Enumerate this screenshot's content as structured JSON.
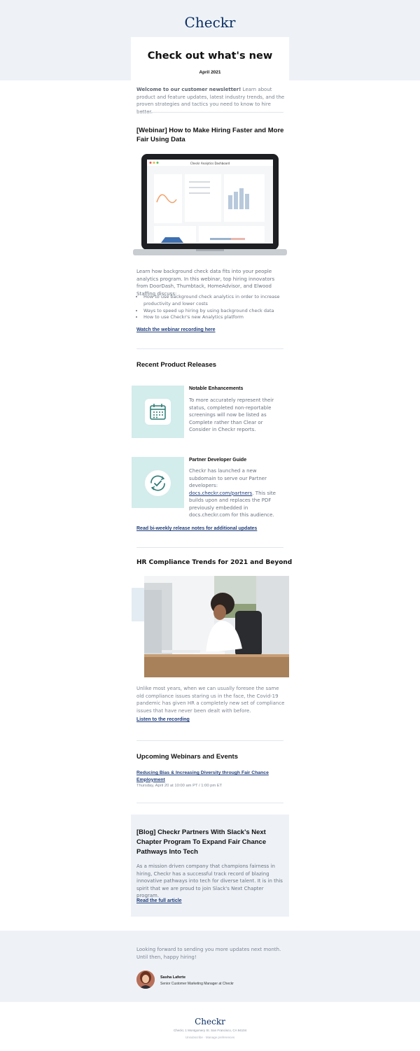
{
  "header": {
    "logo": "Checkr",
    "title": "Check out what's new",
    "date": "April 2021"
  },
  "intro": {
    "bold": "Welcome to our customer newsletter!",
    "text": " Learn about product and feature updates, latest industry trends, and the proven strategies and tactics you need to know to hire better."
  },
  "webinar": {
    "title": "[Webinar] How to Make Hiring Faster and More Fair Using Data",
    "dashboard_title": "Checkr Analytics Dashboard",
    "body": "Learn how background check data fits into your people analytics program. In this webinar, top hiring innovators from DoorDash, Thumbtack, HomeAdvisor, and Elwood Staffing discuss:",
    "bullets": [
      "How to use background check analytics in order to increase productivity and lower costs",
      "Ways to speed up hiring by using background check data",
      "How to use Checkr's new Analytics platform"
    ],
    "link": "Watch the webinar recording here"
  },
  "releases": {
    "title": "Recent Product Releases",
    "items": [
      {
        "title": "Notable Enhancements",
        "text": "To more accurately represent their status, completed non-reportable screenings will now be listed as Complete rather than Clear or Consider in Checkr reports.",
        "icon": "calendar-icon"
      },
      {
        "title": "Partner Developer Guide",
        "text_before": "Checkr has launched a new subdomain to serve our Partner developers: ",
        "link": "docs.checkr.com/partners",
        "text_after": ". This site builds upon and replaces the PDF previously embedded in docs.checkr.com for this audience.",
        "icon": "refresh-check-icon"
      }
    ],
    "link": "Read bi-weekly release notes for additional updates"
  },
  "compliance": {
    "title": "HR Compliance Trends for 2021 and Beyond",
    "body": "Unlike most years, when we can usually foresee the same old compliance issues staring us in the face, the Covid-19 pandemic has given HR a completely new set of compliance issues that have never been dealt with before.",
    "link": "Listen to the recording"
  },
  "events": {
    "title": "Upcoming Webinars and Events",
    "event_link": "Reducing Bias & Increasing Diversity through Fair Chance Employment",
    "event_time": "Thursday, April 20 at 10:00 am PT / 1:00 pm ET"
  },
  "blog": {
    "title": "[Blog] Checkr Partners With Slack's Next Chapter Program To Expand Fair Chance Pathways Into Tech",
    "body": "As a mission driven company that champions fairness in hiring, Checkr has a successful track record of blazing innovative pathways into tech for diverse talent. It is in this spirit that we are proud to join Slack's Next Chapter program.",
    "link": "Read the full article"
  },
  "closing": {
    "text": "Looking forward to sending you more updates next month. Until then, happy hiring!",
    "name": "Sasha Laferte",
    "role": "Senior Customer Marketing Manager at Checkr"
  },
  "footer": {
    "logo": "Checkr",
    "address": "Checkr, 1 Montgomery St. San Francisco, CA 94104",
    "unsubscribe": "Unsubscribe · Manage preferences"
  },
  "colors": {
    "brand": "#0b2e63",
    "band": "#eef2f7",
    "tile": "#d3ecec",
    "accent_teal": "#2a7a74"
  }
}
